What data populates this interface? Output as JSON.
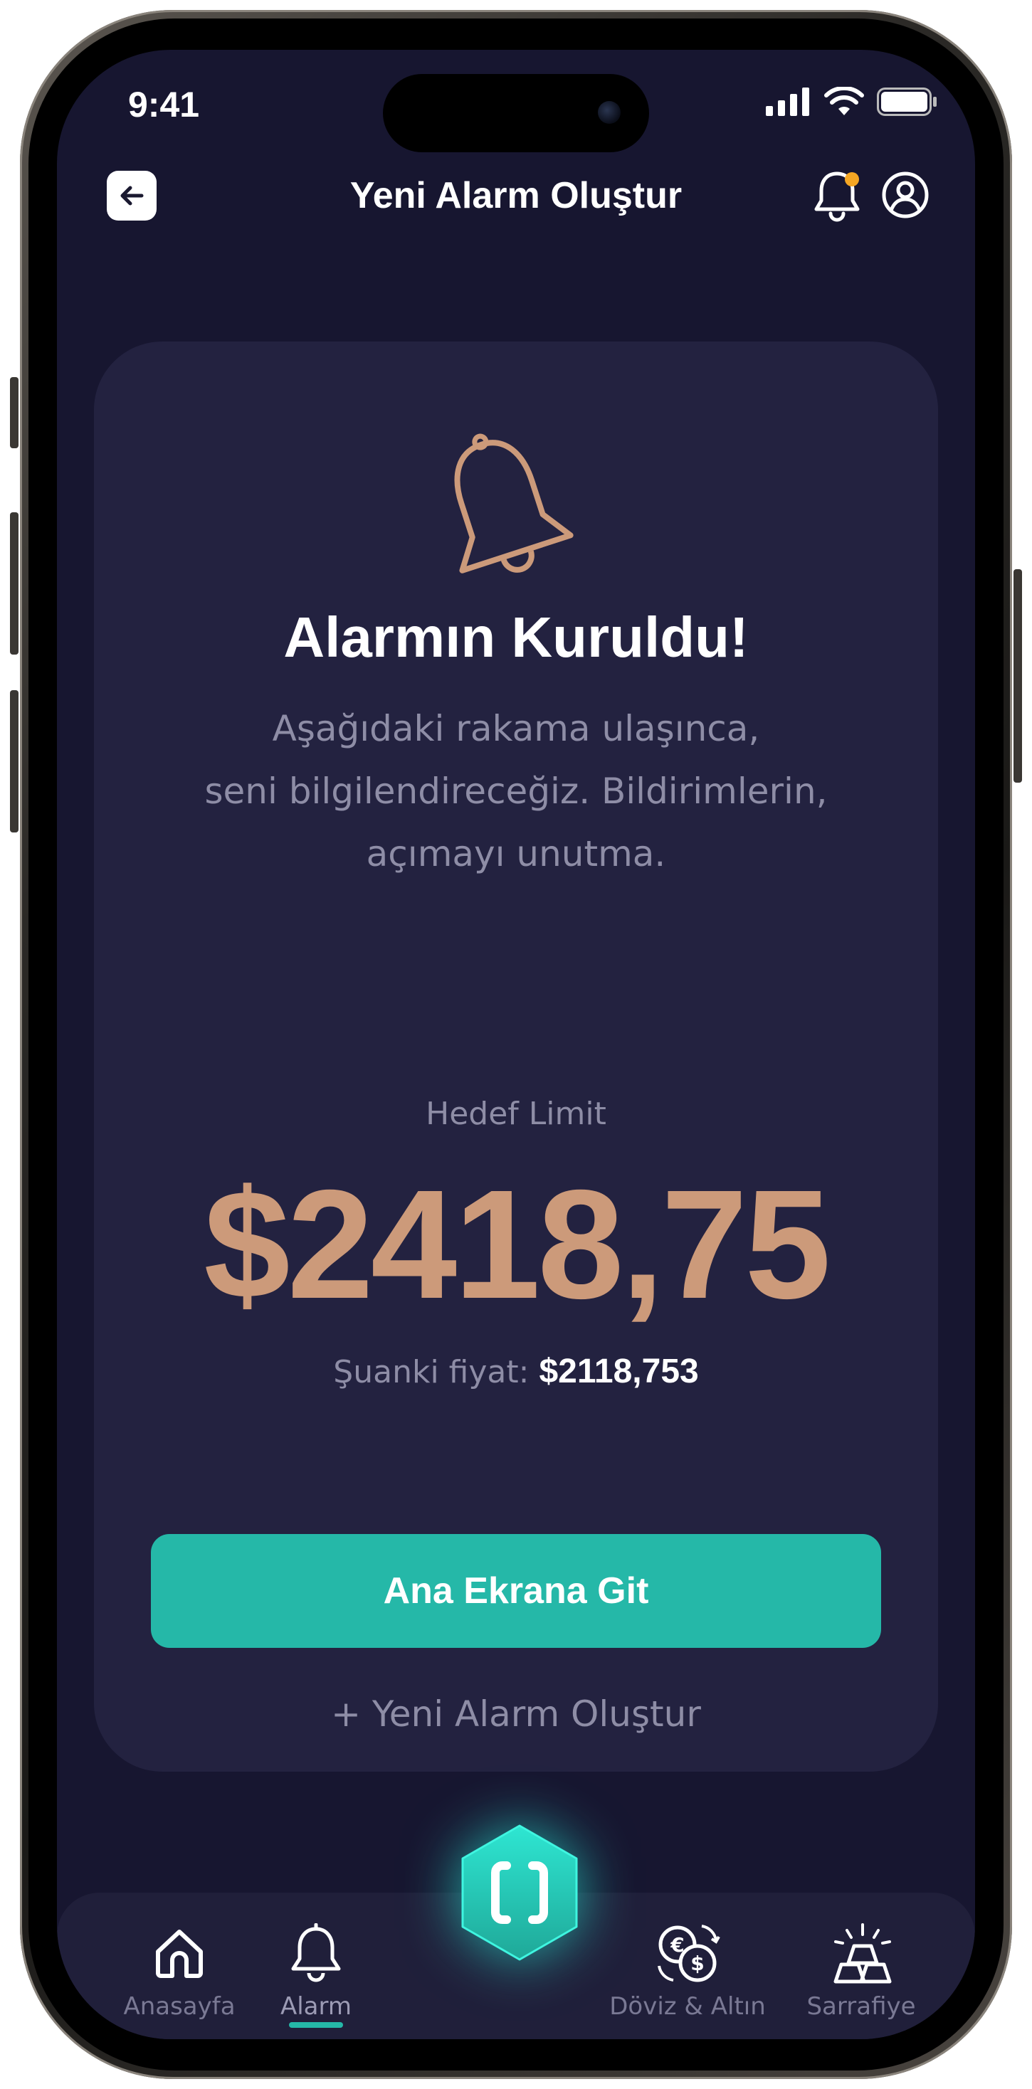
{
  "status_bar": {
    "time": "9:41"
  },
  "header": {
    "title": "Yeni Alarm Oluştur"
  },
  "card": {
    "title": "Alarmın Kuruldu!",
    "description_lines": [
      "Aşağıdaki rakama ulaşınca,",
      "seni bilgilendireceğiz. Bildirimlerin,",
      "açımayı unutma."
    ],
    "target_label": "Hedef Limit",
    "target_value": "$2418,75",
    "current_label": "Şuanki fiyat:",
    "current_value": "$2118,753",
    "primary_button": "Ana Ekrana Git",
    "secondary_link": "+ Yeni Alarm Oluştur"
  },
  "tabbar": {
    "items": [
      {
        "label": "Anasayfa",
        "icon": "home-icon"
      },
      {
        "label": "Alarm",
        "icon": "bell-icon",
        "active": true
      },
      {
        "label": "Döviz & Altın",
        "icon": "currency-exchange-icon"
      },
      {
        "label": "Sarrafiye",
        "icon": "gold-bars-icon"
      }
    ],
    "center_icon": "hexagon-app-icon"
  },
  "colors": {
    "background": "#171630",
    "card": "#232240",
    "accent": "#25b8a8",
    "target": "#cc9a7a",
    "notification_dot": "#f5a623"
  }
}
